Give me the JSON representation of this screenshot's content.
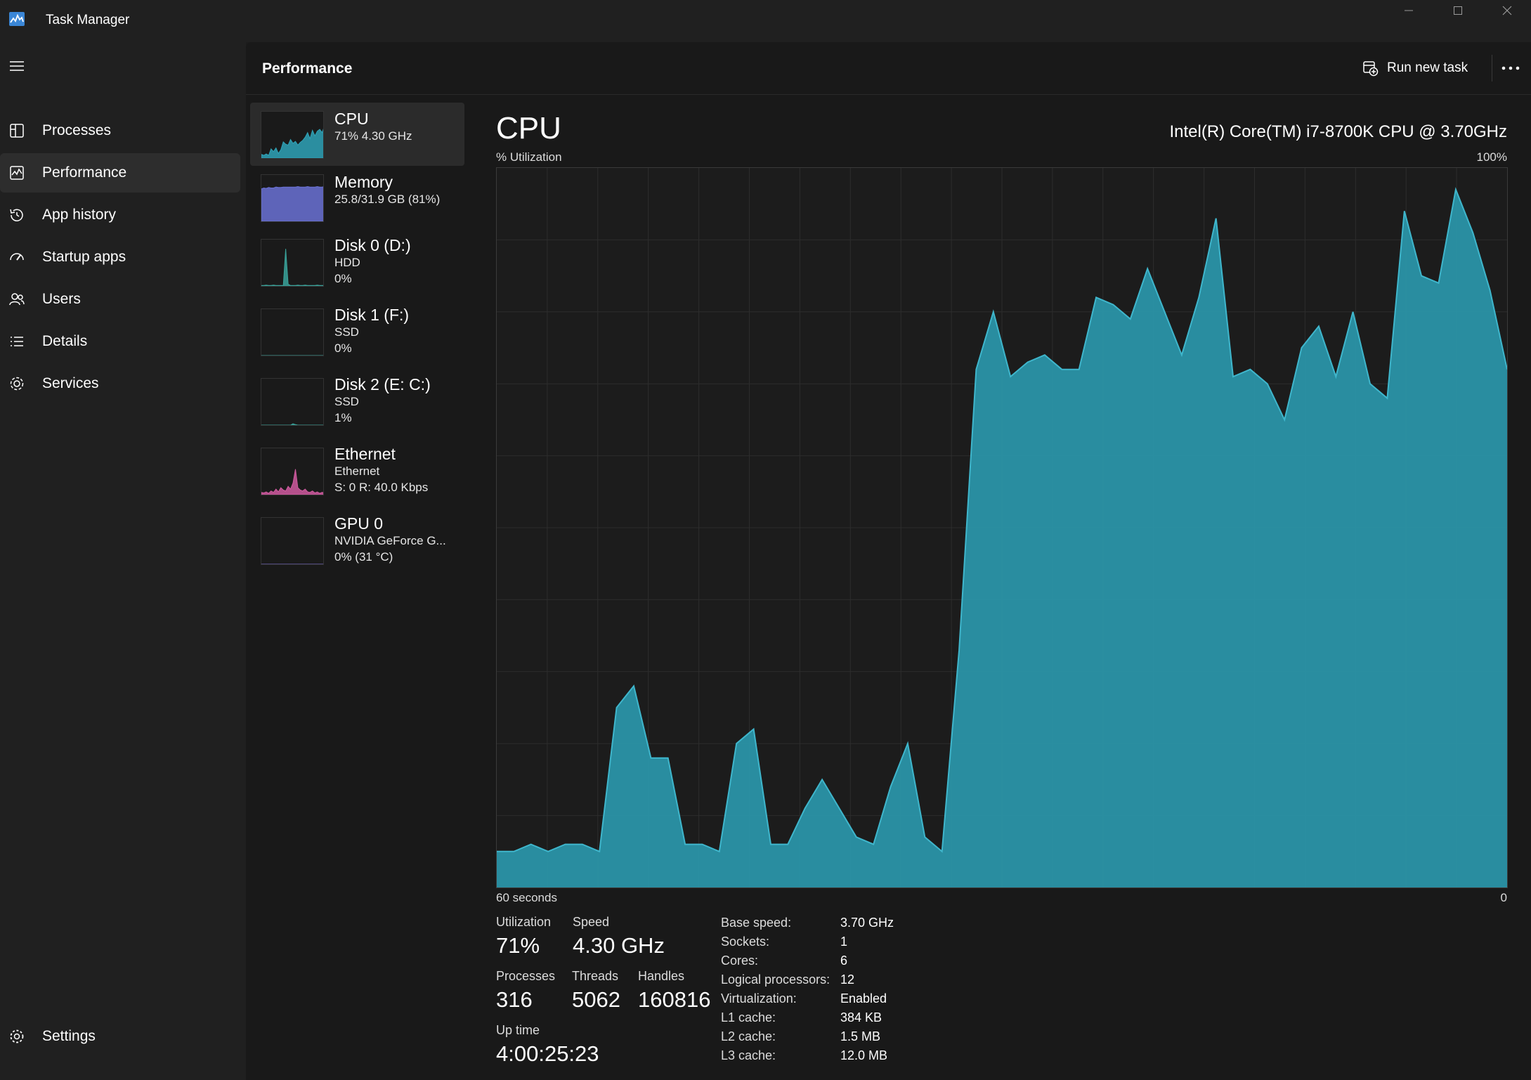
{
  "window": {
    "title": "Task Manager"
  },
  "sidebar": {
    "items": [
      {
        "label": "Processes",
        "icon": "processes-icon"
      },
      {
        "label": "Performance",
        "icon": "performance-icon",
        "active": true
      },
      {
        "label": "App history",
        "icon": "history-icon"
      },
      {
        "label": "Startup apps",
        "icon": "startup-icon"
      },
      {
        "label": "Users",
        "icon": "users-icon"
      },
      {
        "label": "Details",
        "icon": "details-icon"
      },
      {
        "label": "Services",
        "icon": "services-icon"
      }
    ],
    "settings_label": "Settings"
  },
  "header": {
    "title": "Performance",
    "run_new_task": "Run new task"
  },
  "resources": [
    {
      "name": "CPU",
      "sub": [
        "71% 4.30 GHz"
      ],
      "color": "#2fa3b8"
    },
    {
      "name": "Memory",
      "sub": [
        "25.8/31.9 GB (81%)"
      ],
      "color": "#6b72d6"
    },
    {
      "name": "Disk 0 (D:)",
      "sub": [
        "HDD",
        "0%"
      ],
      "color": "#3aa39b"
    },
    {
      "name": "Disk 1 (F:)",
      "sub": [
        "SSD",
        "0%"
      ],
      "color": "#3aa39b"
    },
    {
      "name": "Disk 2 (E: C:)",
      "sub": [
        "SSD",
        "1%"
      ],
      "color": "#3aa39b"
    },
    {
      "name": "Ethernet",
      "sub": [
        "Ethernet",
        "S: 0 R: 40.0 Kbps"
      ],
      "color": "#d05aa0"
    },
    {
      "name": "GPU 0",
      "sub": [
        "NVIDIA GeForce G...",
        "0% (31 °C)"
      ],
      "color": "#7c6fd6"
    }
  ],
  "cpu": {
    "title": "CPU",
    "model": "Intel(R) Core(TM) i7-8700K CPU @ 3.70GHz",
    "util_label": "% Utilization",
    "util_max": "100%",
    "axis_left": "60 seconds",
    "axis_right": "0",
    "stats": {
      "utilization_label": "Utilization",
      "utilization_value": "71%",
      "speed_label": "Speed",
      "speed_value": "4.30 GHz",
      "processes_label": "Processes",
      "processes_value": "316",
      "threads_label": "Threads",
      "threads_value": "5062",
      "handles_label": "Handles",
      "handles_value": "160816",
      "uptime_label": "Up time",
      "uptime_value": "4:00:25:23"
    },
    "details": [
      {
        "key": "Base speed:",
        "value": "3.70 GHz"
      },
      {
        "key": "Sockets:",
        "value": "1"
      },
      {
        "key": "Cores:",
        "value": "6"
      },
      {
        "key": "Logical processors:",
        "value": "12"
      },
      {
        "key": "Virtualization:",
        "value": "Enabled"
      },
      {
        "key": "L1 cache:",
        "value": "384 KB"
      },
      {
        "key": "L2 cache:",
        "value": "1.5 MB"
      },
      {
        "key": "L3 cache:",
        "value": "12.0 MB"
      }
    ],
    "accent_color": "#2a93a8",
    "history": [
      5,
      5,
      6,
      5,
      6,
      6,
      5,
      25,
      28,
      18,
      18,
      6,
      6,
      5,
      20,
      22,
      6,
      6,
      11,
      15,
      11,
      7,
      6,
      14,
      20,
      7,
      5,
      33,
      72,
      80,
      71,
      73,
      74,
      72,
      72,
      82,
      81,
      79,
      86,
      80,
      74,
      82,
      93,
      71,
      72,
      70,
      65,
      75,
      78,
      71,
      80,
      70,
      68,
      94,
      85,
      84,
      97,
      91,
      83,
      72
    ]
  }
}
